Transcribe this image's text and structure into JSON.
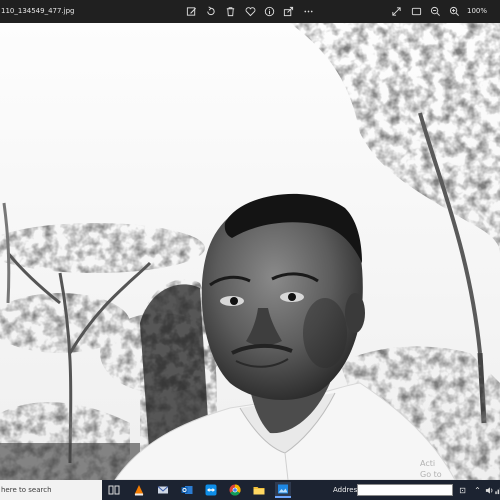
{
  "window": {
    "filename": "110_134549_477.jpg",
    "zoom": "100%",
    "toolbar_icons": [
      "edit-image-icon",
      "rotate-icon",
      "delete-icon",
      "favorite-icon",
      "info-icon",
      "share-icon",
      "more-icon"
    ],
    "right_icons": [
      "fullscreen-icon",
      "aspect-icon",
      "zoom-out-icon",
      "zoom-in-icon"
    ]
  },
  "watermark": {
    "line1": "Acti",
    "line2": "Go to"
  },
  "taskbar": {
    "search_placeholder": "here to search",
    "address_label": "Address",
    "address_value": "",
    "pinned_apps": [
      "task-view-icon",
      "vlc-icon",
      "mail-icon",
      "outlook-icon",
      "teamviewer-icon",
      "chrome-icon",
      "file-explorer-icon",
      "photos-icon"
    ],
    "colors": {
      "taskbar": "#1c2331",
      "accent": "#6fa8ff"
    }
  }
}
